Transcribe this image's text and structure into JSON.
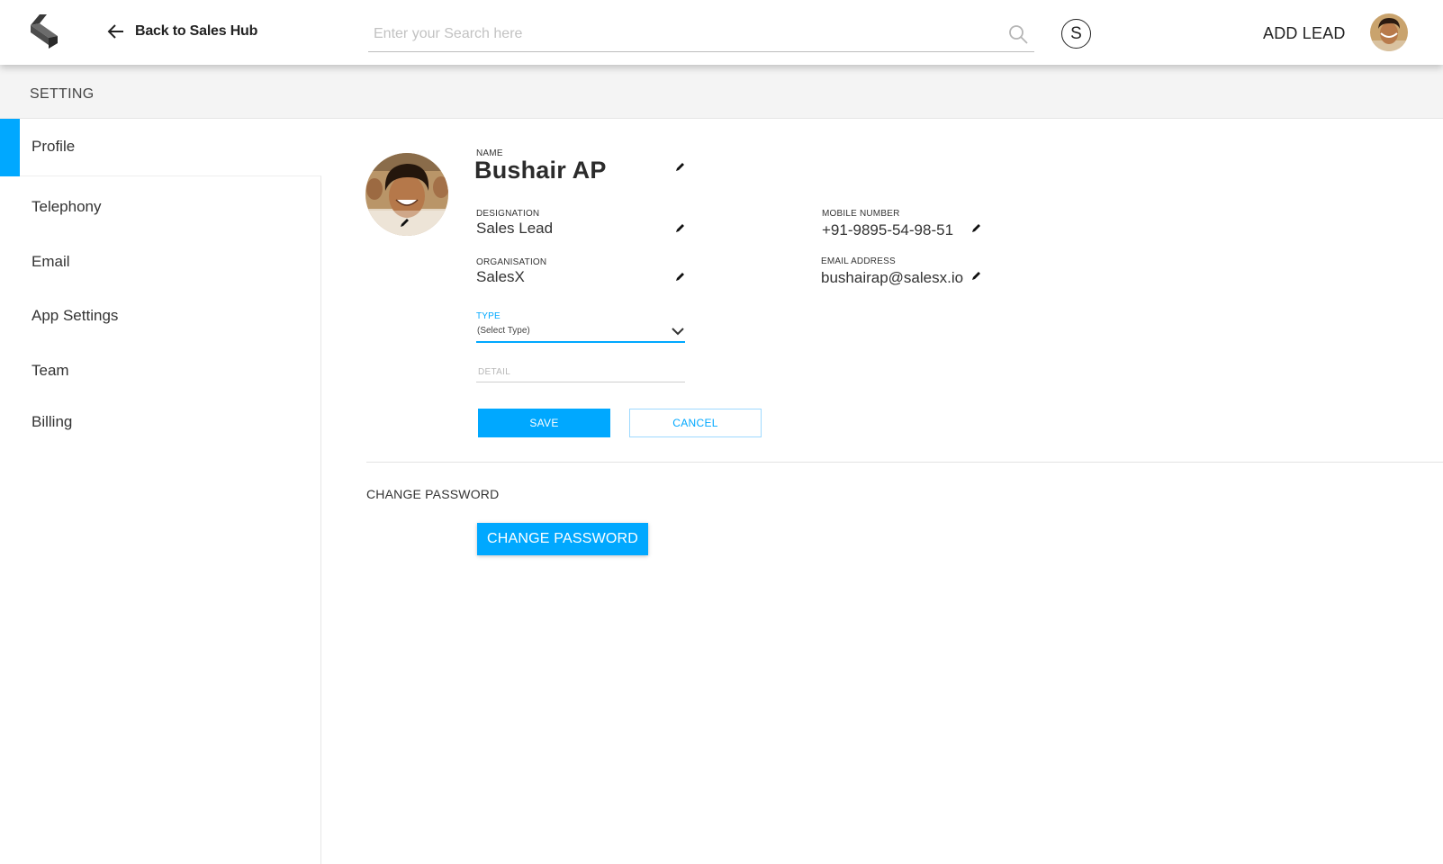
{
  "header": {
    "back_label": "Back to Sales Hub",
    "search_placeholder": "Enter your Search here",
    "switch_initial": "S",
    "add_lead_label": "ADD LEAD"
  },
  "page": {
    "section_title": "SETTING"
  },
  "sidebar": {
    "items": [
      {
        "label": "Profile",
        "active": true
      },
      {
        "label": "Telephony"
      },
      {
        "label": "Email"
      },
      {
        "label": "App Settings"
      },
      {
        "label": "Team"
      },
      {
        "label": "Billing"
      }
    ]
  },
  "profile": {
    "name_label": "NAME",
    "name": "Bushair AP",
    "designation_label": "DESIGNATION",
    "designation": "Sales Lead",
    "organisation_label": "ORGANISATION",
    "organisation": "SalesX",
    "mobile_label": "MOBILE NUMBER",
    "mobile": "+91-9895-54-98-51",
    "email_label": "EMAIL ADDRESS",
    "email": "bushairap@salesx.io",
    "type_label": "TYPE",
    "type_value": "(Select Type)",
    "detail_placeholder": "DETAIL",
    "save_label": "SAVE",
    "cancel_label": "CANCEL"
  },
  "password": {
    "heading": "CHANGE PASSWORD",
    "button_label": "CHANGE PASSWORD"
  },
  "colors": {
    "accent": "#00a8ff"
  }
}
